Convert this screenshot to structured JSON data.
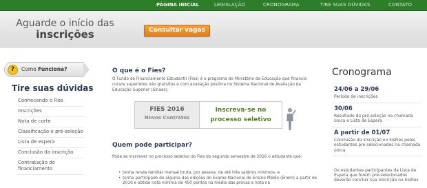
{
  "nav": {
    "items": [
      {
        "label": "PÁGINA INICIAL",
        "active": true
      },
      {
        "label": "LEGISLAÇÃO",
        "active": false
      },
      {
        "label": "CRONOGRAMA",
        "active": false
      },
      {
        "label": "TIRE SUAS DÚVIDAS",
        "active": false
      },
      {
        "label": "CONTATO",
        "active": false
      }
    ]
  },
  "header": {
    "title_line1": "Aguarde o início das",
    "title_line2": "inscrições",
    "cta_label": "Consultar vagas"
  },
  "sidebar": {
    "how_button": {
      "prefix": "Como ",
      "bold": "Funciona?"
    },
    "title": "Tire suas dúvidas",
    "items": [
      {
        "label": "Conhecendo o Fies"
      },
      {
        "label": "Inscrições"
      },
      {
        "label": "Nota de corte"
      },
      {
        "label": "Classificação e pré-seleção"
      },
      {
        "label": "Lista de espera"
      },
      {
        "label": "Conclusão da inscrição"
      },
      {
        "label": "Contratação do financiamento"
      }
    ]
  },
  "main": {
    "what_title": "O que é o Fies?",
    "what_text": "O Fundo de Financiamento Estudantil (Fies) é o programa do Ministério da Educação que financia cursos superiores não gratuitos e com avaliação positiva no Sistema Nacional de Avaliação da Educação Superior (Sinaes).",
    "fies_box": {
      "line1": "FIES 2016",
      "line2": "Novos Contratos"
    },
    "subscribe_box": {
      "line1": "Inscreva-se no",
      "line2": "processo seletivo"
    },
    "who_title": "Quem pode participar?",
    "who_text": "Pode se inscrever no processo seletivo do Fies do segundo semestre de 2016 o estudante que:",
    "bullets": [
      "tenha renda familiar mensal bruta, por pessoa, de até três salários mínimos; e",
      "tenha participado de alguma das edições do Exame Nacional do Ensino Médio (Enem) a partir de 2010 e obtido nota mínima de 450 pontos na média das provas e nota na"
    ]
  },
  "cronograma": {
    "title": "Cronograma",
    "items": [
      {
        "date": "24/06 a 29/06",
        "desc": "Período de inscrições"
      },
      {
        "date": "30/06",
        "desc": "Resultado da pré-seleção na chamada única e Lista de Espera"
      },
      {
        "date": "A partir de 01/07",
        "desc": "Conclusão da inscrição no SisFies pelos estudantes pré-selecionados na chamada única"
      }
    ],
    "note": "Os estudantes participantes da Lista de Espera que forem pré-selecionados deverão concluir sua inscrição no SisFies"
  },
  "colors": {
    "nav_green": "#2e7d2a",
    "cta_orange": "#e98a1f",
    "heading_navy": "#2d3a55",
    "subscribe_green": "#5a7f23"
  }
}
